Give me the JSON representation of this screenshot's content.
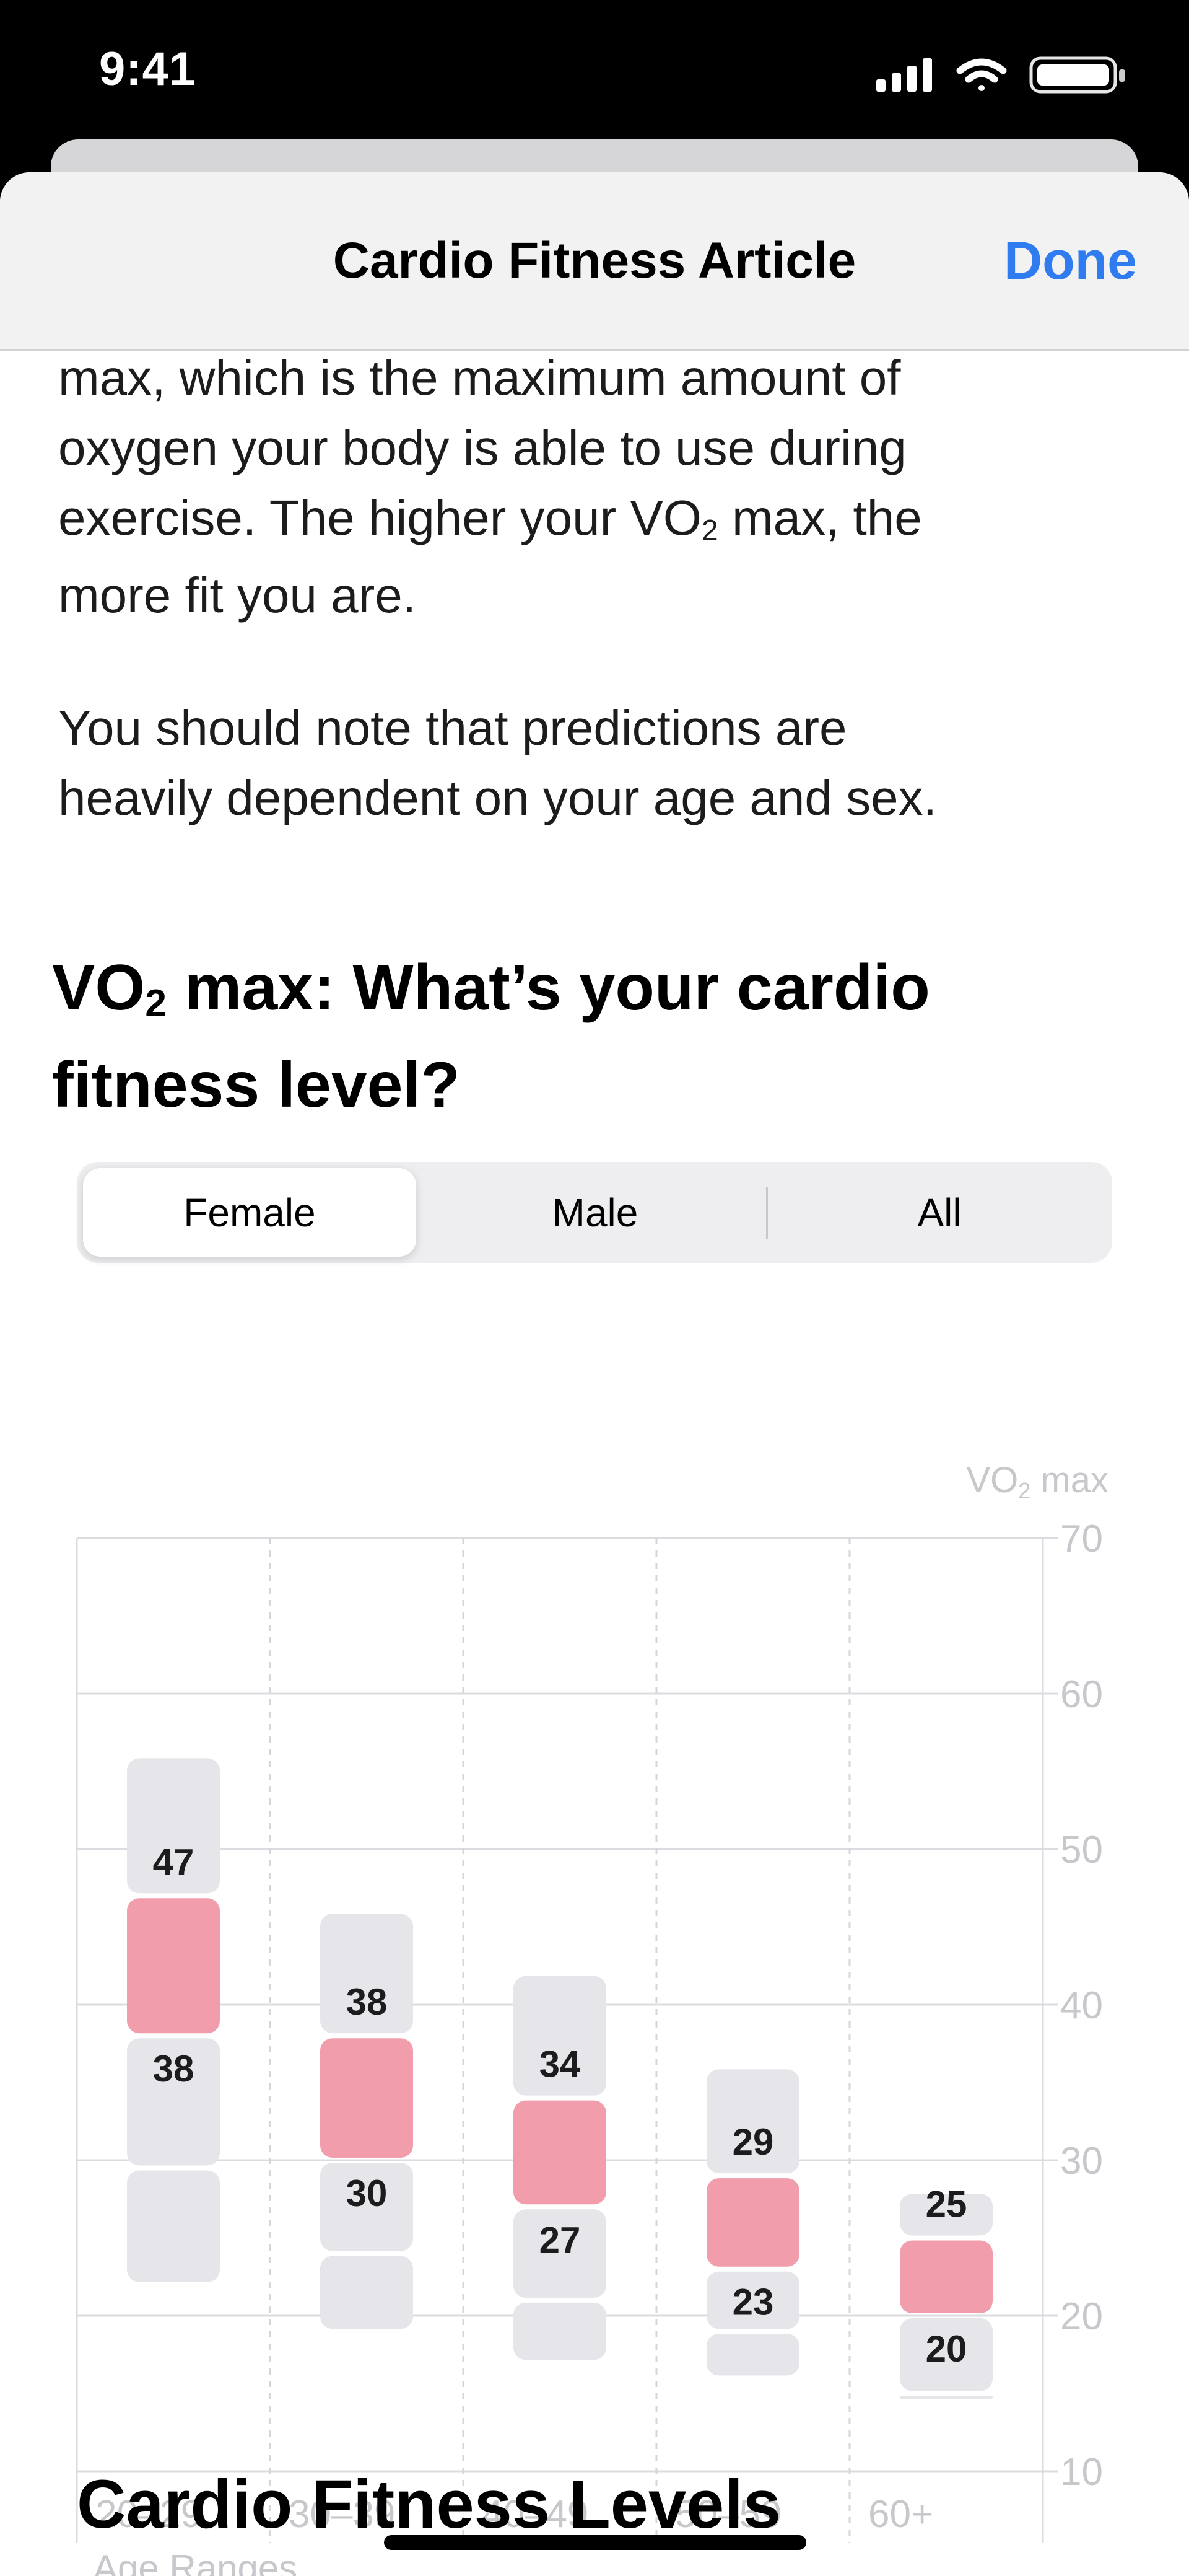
{
  "status_bar": {
    "time": "9:41",
    "icons": [
      "cellular-signal-icon",
      "wifi-icon",
      "battery-icon"
    ]
  },
  "nav": {
    "title": "Cardio Fitness Article",
    "done_label": "Done",
    "done_color": "#2f7bf0"
  },
  "article": {
    "para1_lines": [
      "max, which is the maximum amount of",
      "oxygen your body is able to use during",
      "exercise. The higher your VO",
      "2",
      " max, the",
      "more fit you are."
    ],
    "para2_lines": [
      "You should note that predictions are",
      "heavily dependent on your age and sex."
    ],
    "heading_prefix": "VO",
    "heading_sub": "2",
    "heading_rest": " max: What’s your cardio",
    "heading_line2": "fitness level?"
  },
  "segmented_control": {
    "options": [
      "Female",
      "Male",
      "All"
    ],
    "selected": "Female"
  },
  "chart_data": {
    "type": "bar",
    "title": "",
    "ylabel_prefix": "VO",
    "ylabel_sub": "2",
    "ylabel_rest": " max",
    "xlabel": "Age Ranges",
    "ylim": [
      10,
      70
    ],
    "yticks": [
      70,
      60,
      50,
      40,
      30,
      20,
      10
    ],
    "categories": [
      "20–29",
      "30–39",
      "40–49",
      "50–59",
      "60+"
    ],
    "highlight_color": "#f19dab",
    "range_color": "#e5e5ea",
    "grid": true,
    "bars": [
      {
        "category": "20–29",
        "full_low": 22,
        "full_high": 56,
        "gray_split": 29.5,
        "pink_low": 38,
        "pink_high": 47,
        "top_label": "47",
        "bottom_label": "38"
      },
      {
        "category": "30–39",
        "full_low": 19,
        "full_high": 46,
        "gray_split": 24,
        "pink_low": 30,
        "pink_high": 38,
        "top_label": "38",
        "bottom_label": "30"
      },
      {
        "category": "40–49",
        "full_low": 17,
        "full_high": 42,
        "gray_split": 21,
        "pink_low": 27,
        "pink_high": 34,
        "top_label": "34",
        "bottom_label": "27"
      },
      {
        "category": "50–59",
        "full_low": 16,
        "full_high": 36,
        "gray_split": 19,
        "pink_low": 23,
        "pink_high": 29,
        "top_label": "29",
        "bottom_label": "23"
      },
      {
        "category": "60+",
        "full_low": 14.5,
        "full_high": 28,
        "gray_split": 15,
        "pink_low": 20,
        "pink_high": 25,
        "top_label": "25",
        "bottom_label": "20"
      }
    ]
  },
  "section": {
    "title": "Cardio Fitness Levels"
  }
}
